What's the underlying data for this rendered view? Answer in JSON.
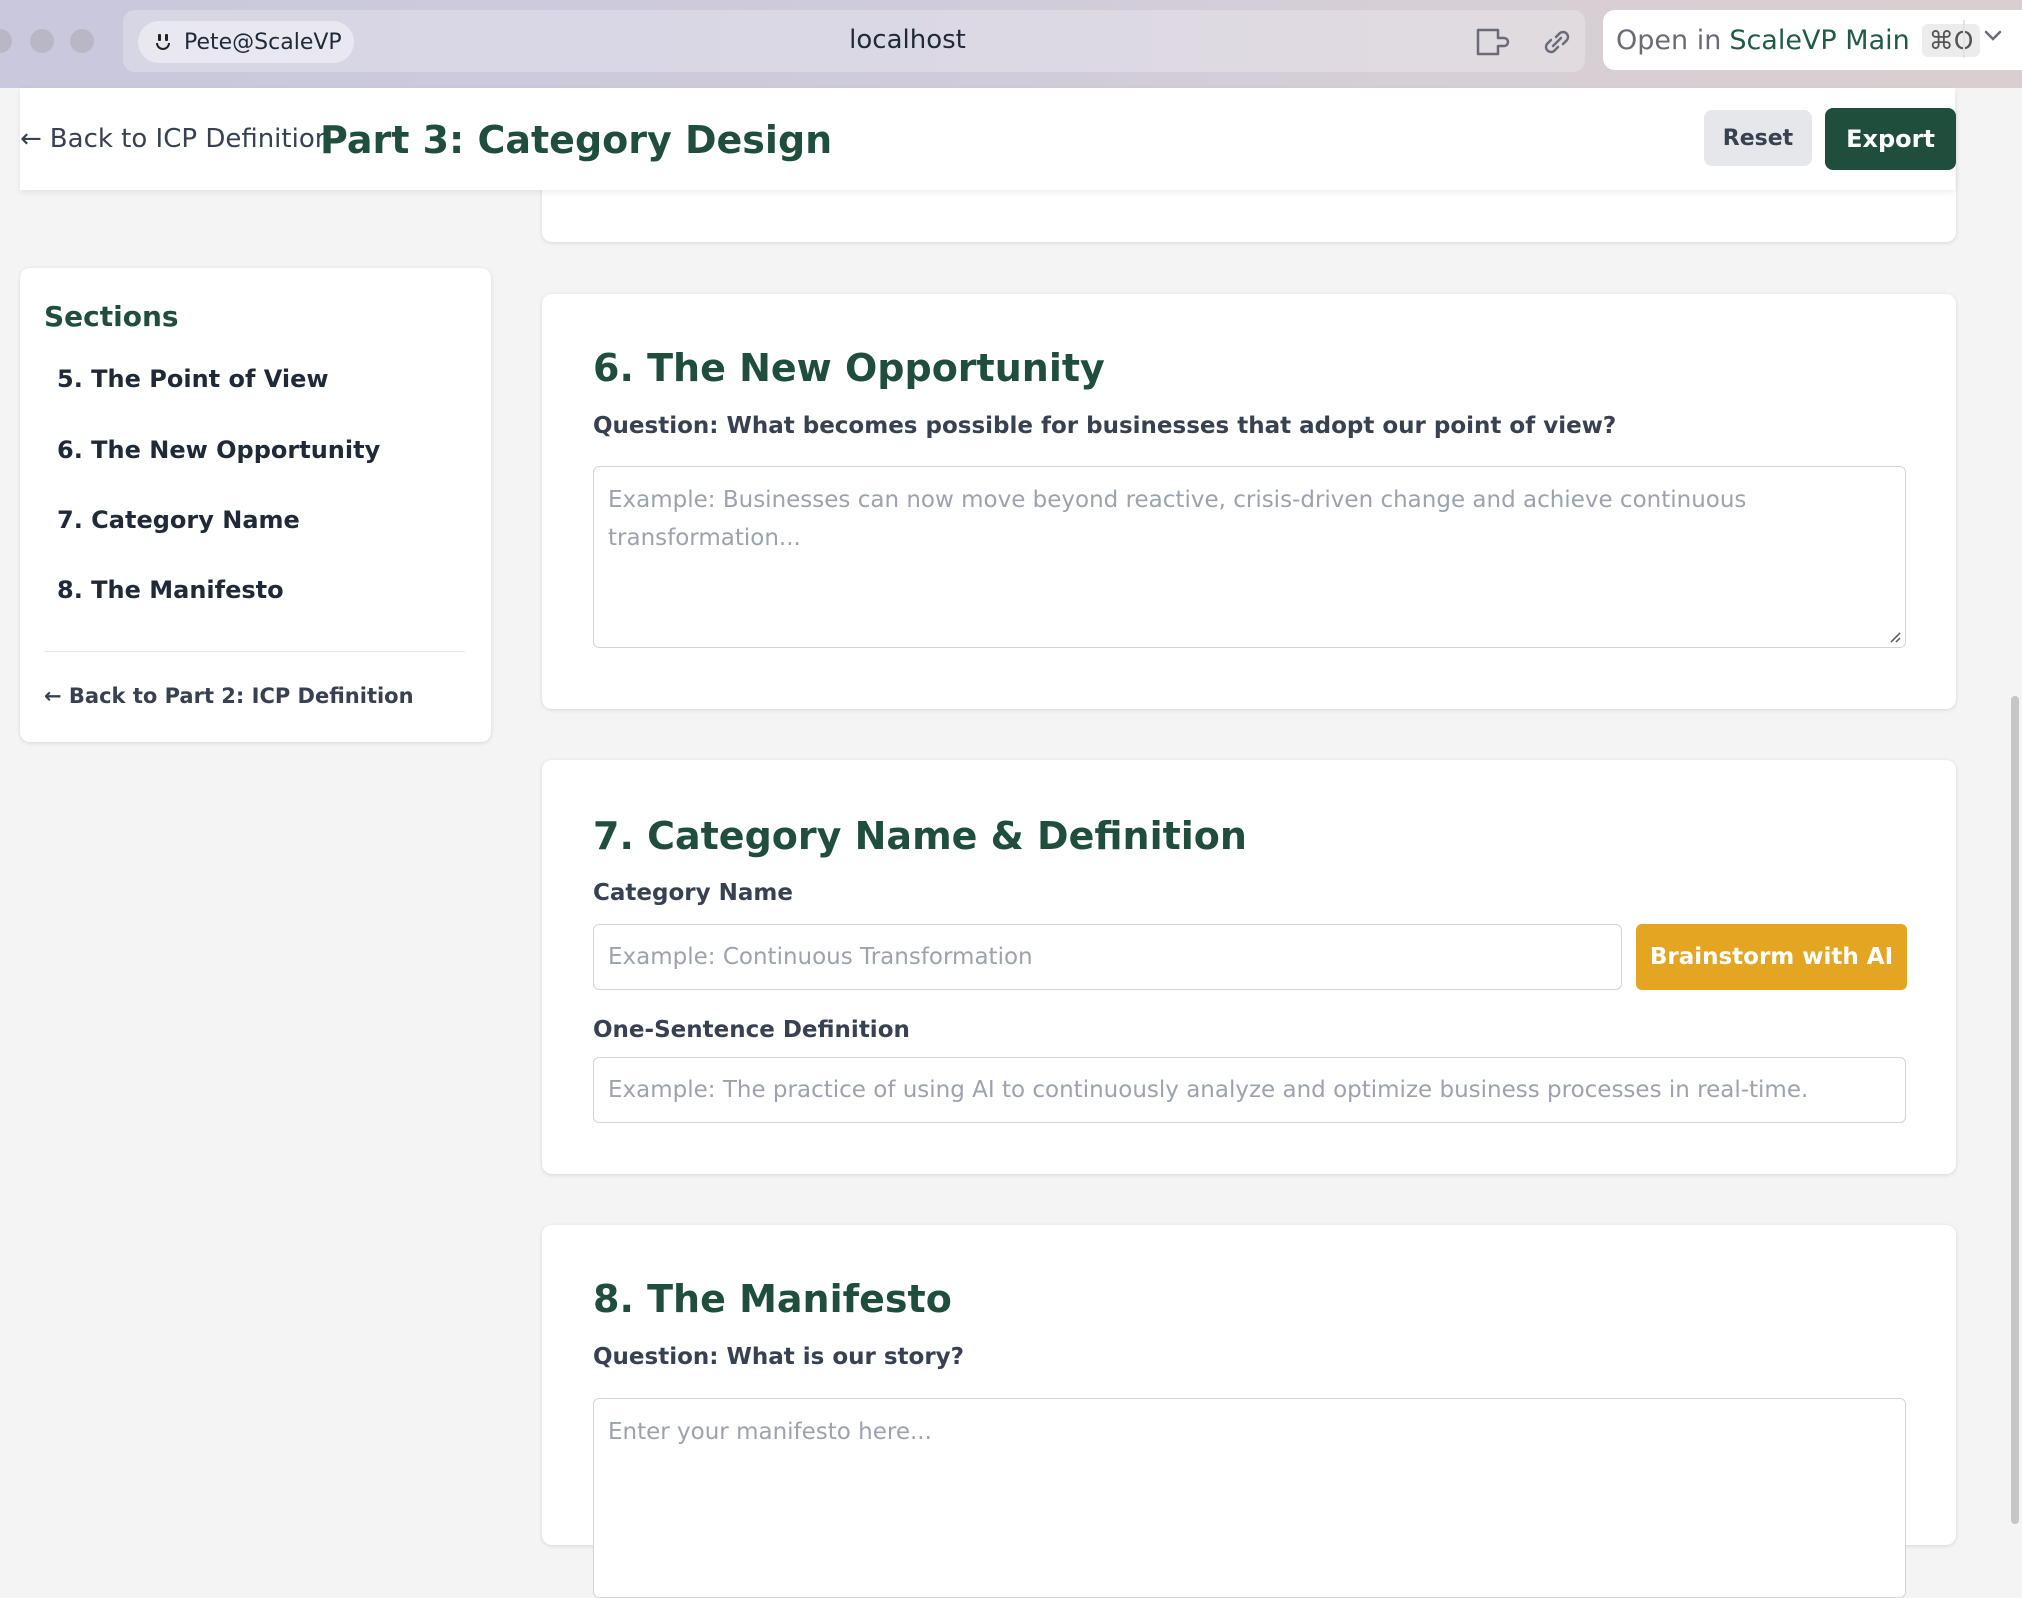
{
  "browser": {
    "profile": "Pete@ScaleVP",
    "url": "localhost",
    "open_in_prefix": "Open in",
    "open_in_app": "ScaleVP Main",
    "open_in_shortcut": "⌘O"
  },
  "header": {
    "back_link": "Back to ICP Definition",
    "title": "Part 3: Category Design",
    "reset_label": "Reset",
    "export_label": "Export"
  },
  "sidebar": {
    "title": "Sections",
    "items": [
      {
        "label": "5. The Point of View"
      },
      {
        "label": "6. The New Opportunity"
      },
      {
        "label": "7. Category Name"
      },
      {
        "label": "8. The Manifesto"
      }
    ],
    "back_link": "Back to Part 2: ICP Definition"
  },
  "sections": {
    "opportunity": {
      "title": "6. The New Opportunity",
      "question": "Question: What becomes possible for businesses that adopt our point of view?",
      "placeholder": "Example: Businesses can now move beyond reactive, crisis-driven change and achieve continuous transformation..."
    },
    "category": {
      "title": "7. Category Name & Definition",
      "name_label": "Category Name",
      "name_placeholder": "Example: Continuous Transformation",
      "brainstorm_label": "Brainstorm with AI",
      "definition_label": "One-Sentence Definition",
      "definition_placeholder": "Example: The practice of using AI to continuously analyze and optimize business processes in real-time."
    },
    "manifesto": {
      "title": "8. The Manifesto",
      "question": "Question: What is our story?",
      "placeholder": "Enter your manifesto here..."
    }
  },
  "colors": {
    "brand_green": "#1f4e3d",
    "accent_gold": "#e4a622"
  }
}
